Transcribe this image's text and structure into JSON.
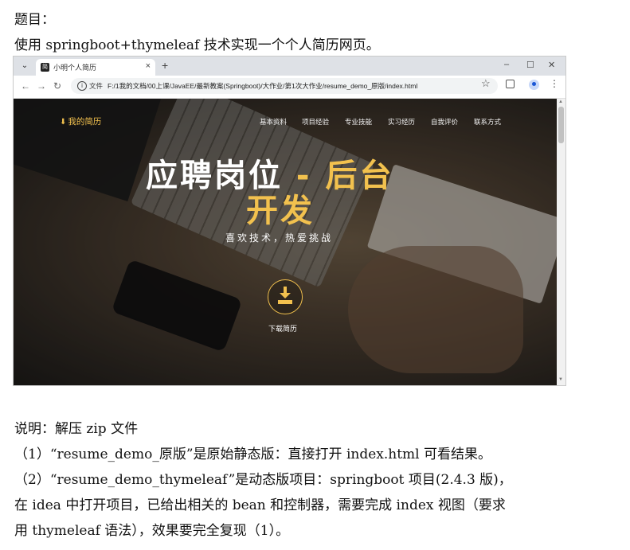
{
  "document": {
    "title_line": "题目：",
    "task_line": "使用 springboot+thymeleaf 技术实现一个个人简历网页。",
    "notes": [
      "说明：解压 zip 文件",
      "（1）“resume_demo_原版”是原始静态版：直接打开 index.html 可看结果。",
      "（2）“resume_demo_thymeleaf”是动态版项目：springboot 项目(2.4.3 版)，",
      "在 idea 中打开项目，已给出相关的 bean 和控制器，需要完成 index 视图（要求",
      "用 thymeleaf 语法），效果要完全复现（1）。"
    ]
  },
  "browser": {
    "tab_title": "小明个人简历",
    "tab_icon": "简",
    "file_label": "文件",
    "url": "F:/1我的文档/00上课/JavaEE/最新教案(Springboot)/大作业/第1次大作业/resume_demo_原版/index.html",
    "icons": [
      "dropdown-icon",
      "close-icon",
      "plus-icon",
      "minimize-icon",
      "maximize-icon",
      "window-close-icon",
      "back-icon",
      "forward-icon",
      "reload-icon",
      "info-icon",
      "star-icon",
      "extension-icon",
      "profile-icon",
      "menu-icon"
    ]
  },
  "site": {
    "brand": "我的简历",
    "nav": [
      "基本资料",
      "项目经验",
      "专业技能",
      "实习经历",
      "自我评价",
      "联系方式"
    ],
    "hero_part1": "应聘岗位",
    "hero_dash": " - ",
    "hero_part2": "后台",
    "hero_line2": "开发",
    "tagline": "喜欢技术，热爱挑战",
    "download_label": "下载简历",
    "accent_color": "#f2c14e"
  }
}
